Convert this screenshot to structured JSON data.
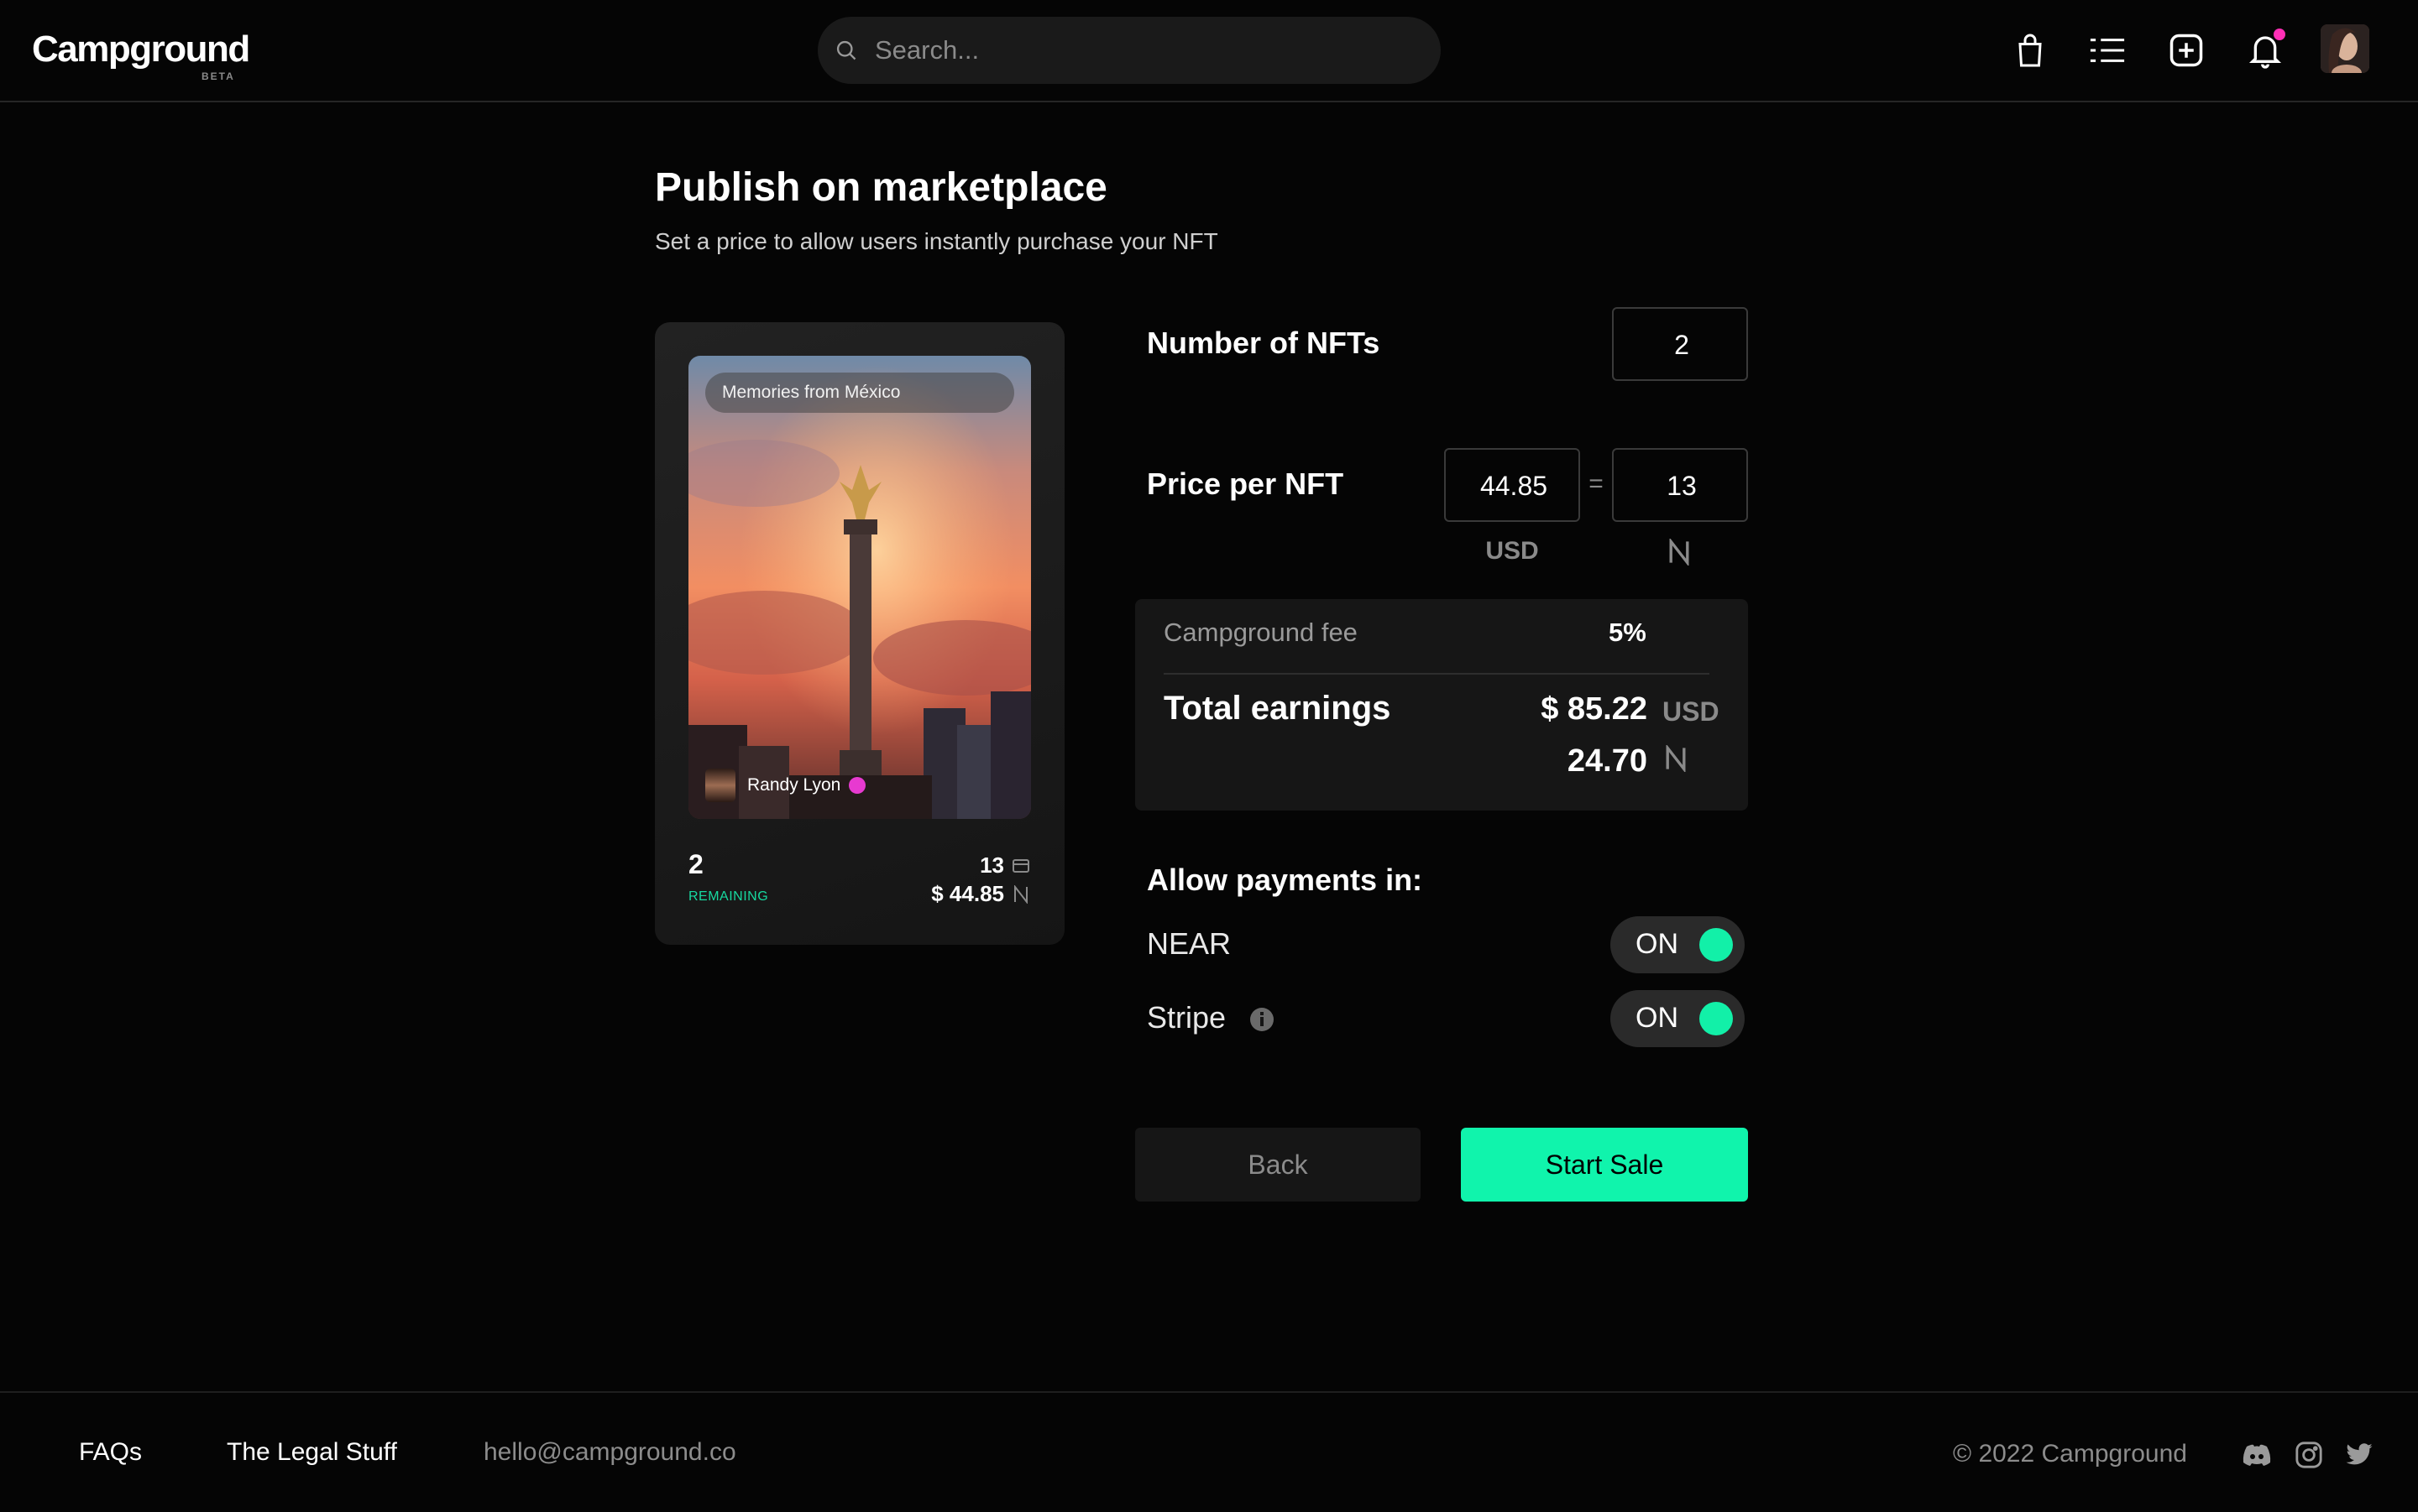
{
  "header": {
    "logo": "Campground",
    "beta": "BETA",
    "search_placeholder": "Search...",
    "icons": [
      "bag-icon",
      "list-icon",
      "add-icon",
      "bell-icon"
    ],
    "notification_color": "#ff2fb6"
  },
  "page": {
    "title": "Publish on marketplace",
    "subtitle": "Set a price to allow users instantly purchase your NFT"
  },
  "card": {
    "tag": "Memories from México",
    "author": "Randy Lyon",
    "count": "2",
    "remaining_label": "REMAINING",
    "editions": "13",
    "price": "$ 44.85"
  },
  "form": {
    "nft_count_label": "Number of NFTs",
    "nft_count_value": "2",
    "price_label": "Price per NFT",
    "price_usd": "44.85",
    "equals": "=",
    "price_near": "13",
    "usd_unit": "USD",
    "fee_label": "Campground fee",
    "fee_value": "5%",
    "total_label": "Total earnings",
    "total_usd": "$ 85.22",
    "total_usd_unit": "USD",
    "total_near": "24.70"
  },
  "payments": {
    "title": "Allow payments in:",
    "near_label": "NEAR",
    "near_state": "ON",
    "stripe_label": "Stripe",
    "stripe_state": "ON"
  },
  "actions": {
    "back": "Back",
    "start": "Start Sale"
  },
  "footer": {
    "faqs": "FAQs",
    "legal": "The Legal Stuff",
    "email": "hello@campground.co",
    "copyright": "© 2022 Campground"
  },
  "colors": {
    "accent": "#10f4ac",
    "background": "#050505",
    "panel": "#161616"
  }
}
